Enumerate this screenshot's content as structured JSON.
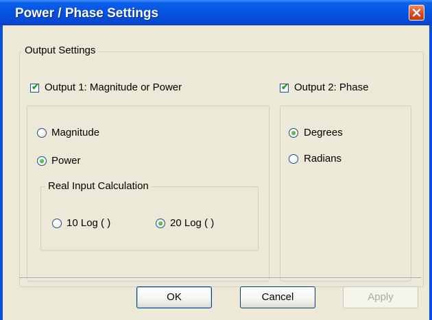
{
  "window": {
    "title": "Power / Phase Settings"
  },
  "output_settings": {
    "group_label": "Output Settings",
    "output1": {
      "label": "Output 1: Magnitude or Power",
      "checked": true,
      "options": [
        {
          "label": "Magnitude",
          "selected": false
        },
        {
          "label": "Power",
          "selected": true
        }
      ],
      "real_input": {
        "group_label": "Real Input Calculation",
        "options": [
          {
            "label": "10 Log ( )",
            "selected": false
          },
          {
            "label": "20 Log ( )",
            "selected": true
          }
        ]
      }
    },
    "output2": {
      "label": "Output 2: Phase",
      "checked": true,
      "options": [
        {
          "label": "Degrees",
          "selected": true
        },
        {
          "label": "Radians",
          "selected": false
        }
      ]
    }
  },
  "buttons": {
    "ok": "OK",
    "cancel": "Cancel",
    "apply": "Apply"
  }
}
